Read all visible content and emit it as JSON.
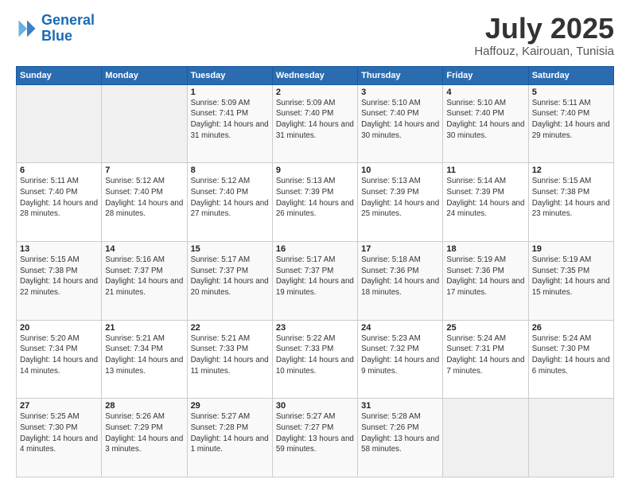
{
  "header": {
    "logo_text1": "General",
    "logo_text2": "Blue",
    "month": "July 2025",
    "location": "Haffouz, Kairouan, Tunisia"
  },
  "calendar": {
    "headers": [
      "Sunday",
      "Monday",
      "Tuesday",
      "Wednesday",
      "Thursday",
      "Friday",
      "Saturday"
    ],
    "rows": [
      [
        {
          "day": "",
          "info": ""
        },
        {
          "day": "",
          "info": ""
        },
        {
          "day": "1",
          "info": "Sunrise: 5:09 AM\nSunset: 7:41 PM\nDaylight: 14 hours and 31 minutes."
        },
        {
          "day": "2",
          "info": "Sunrise: 5:09 AM\nSunset: 7:40 PM\nDaylight: 14 hours and 31 minutes."
        },
        {
          "day": "3",
          "info": "Sunrise: 5:10 AM\nSunset: 7:40 PM\nDaylight: 14 hours and 30 minutes."
        },
        {
          "day": "4",
          "info": "Sunrise: 5:10 AM\nSunset: 7:40 PM\nDaylight: 14 hours and 30 minutes."
        },
        {
          "day": "5",
          "info": "Sunrise: 5:11 AM\nSunset: 7:40 PM\nDaylight: 14 hours and 29 minutes."
        }
      ],
      [
        {
          "day": "6",
          "info": "Sunrise: 5:11 AM\nSunset: 7:40 PM\nDaylight: 14 hours and 28 minutes."
        },
        {
          "day": "7",
          "info": "Sunrise: 5:12 AM\nSunset: 7:40 PM\nDaylight: 14 hours and 28 minutes."
        },
        {
          "day": "8",
          "info": "Sunrise: 5:12 AM\nSunset: 7:40 PM\nDaylight: 14 hours and 27 minutes."
        },
        {
          "day": "9",
          "info": "Sunrise: 5:13 AM\nSunset: 7:39 PM\nDaylight: 14 hours and 26 minutes."
        },
        {
          "day": "10",
          "info": "Sunrise: 5:13 AM\nSunset: 7:39 PM\nDaylight: 14 hours and 25 minutes."
        },
        {
          "day": "11",
          "info": "Sunrise: 5:14 AM\nSunset: 7:39 PM\nDaylight: 14 hours and 24 minutes."
        },
        {
          "day": "12",
          "info": "Sunrise: 5:15 AM\nSunset: 7:38 PM\nDaylight: 14 hours and 23 minutes."
        }
      ],
      [
        {
          "day": "13",
          "info": "Sunrise: 5:15 AM\nSunset: 7:38 PM\nDaylight: 14 hours and 22 minutes."
        },
        {
          "day": "14",
          "info": "Sunrise: 5:16 AM\nSunset: 7:37 PM\nDaylight: 14 hours and 21 minutes."
        },
        {
          "day": "15",
          "info": "Sunrise: 5:17 AM\nSunset: 7:37 PM\nDaylight: 14 hours and 20 minutes."
        },
        {
          "day": "16",
          "info": "Sunrise: 5:17 AM\nSunset: 7:37 PM\nDaylight: 14 hours and 19 minutes."
        },
        {
          "day": "17",
          "info": "Sunrise: 5:18 AM\nSunset: 7:36 PM\nDaylight: 14 hours and 18 minutes."
        },
        {
          "day": "18",
          "info": "Sunrise: 5:19 AM\nSunset: 7:36 PM\nDaylight: 14 hours and 17 minutes."
        },
        {
          "day": "19",
          "info": "Sunrise: 5:19 AM\nSunset: 7:35 PM\nDaylight: 14 hours and 15 minutes."
        }
      ],
      [
        {
          "day": "20",
          "info": "Sunrise: 5:20 AM\nSunset: 7:34 PM\nDaylight: 14 hours and 14 minutes."
        },
        {
          "day": "21",
          "info": "Sunrise: 5:21 AM\nSunset: 7:34 PM\nDaylight: 14 hours and 13 minutes."
        },
        {
          "day": "22",
          "info": "Sunrise: 5:21 AM\nSunset: 7:33 PM\nDaylight: 14 hours and 11 minutes."
        },
        {
          "day": "23",
          "info": "Sunrise: 5:22 AM\nSunset: 7:33 PM\nDaylight: 14 hours and 10 minutes."
        },
        {
          "day": "24",
          "info": "Sunrise: 5:23 AM\nSunset: 7:32 PM\nDaylight: 14 hours and 9 minutes."
        },
        {
          "day": "25",
          "info": "Sunrise: 5:24 AM\nSunset: 7:31 PM\nDaylight: 14 hours and 7 minutes."
        },
        {
          "day": "26",
          "info": "Sunrise: 5:24 AM\nSunset: 7:30 PM\nDaylight: 14 hours and 6 minutes."
        }
      ],
      [
        {
          "day": "27",
          "info": "Sunrise: 5:25 AM\nSunset: 7:30 PM\nDaylight: 14 hours and 4 minutes."
        },
        {
          "day": "28",
          "info": "Sunrise: 5:26 AM\nSunset: 7:29 PM\nDaylight: 14 hours and 3 minutes."
        },
        {
          "day": "29",
          "info": "Sunrise: 5:27 AM\nSunset: 7:28 PM\nDaylight: 14 hours and 1 minute."
        },
        {
          "day": "30",
          "info": "Sunrise: 5:27 AM\nSunset: 7:27 PM\nDaylight: 13 hours and 59 minutes."
        },
        {
          "day": "31",
          "info": "Sunrise: 5:28 AM\nSunset: 7:26 PM\nDaylight: 13 hours and 58 minutes."
        },
        {
          "day": "",
          "info": ""
        },
        {
          "day": "",
          "info": ""
        }
      ]
    ]
  }
}
